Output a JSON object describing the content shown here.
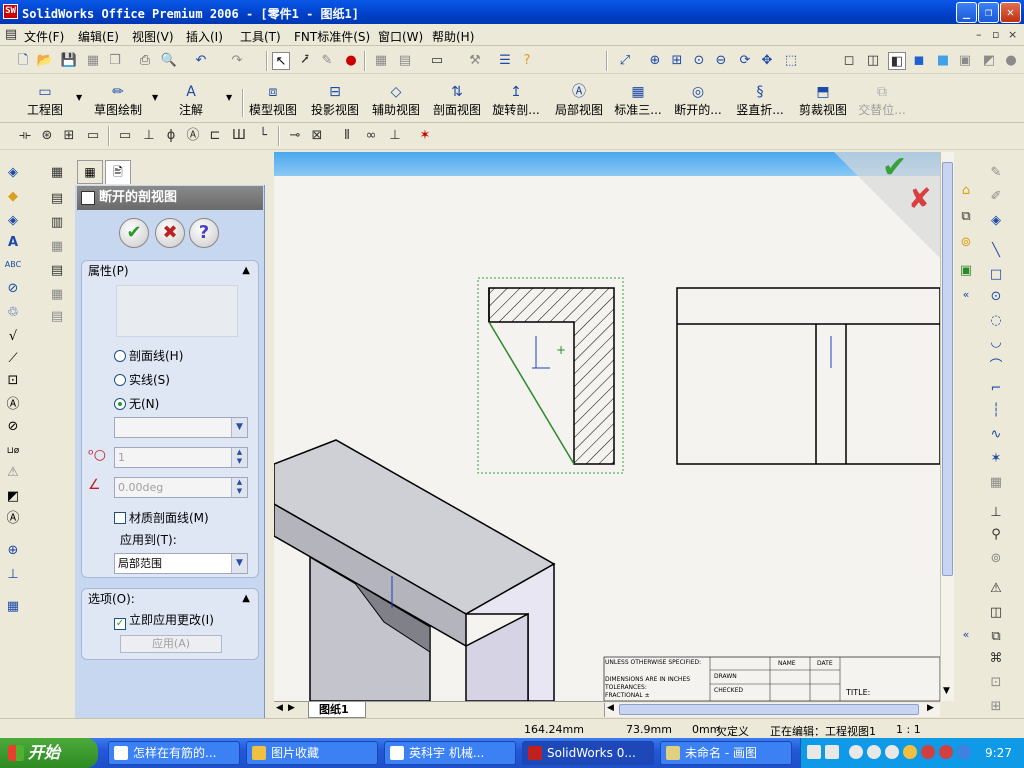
{
  "window": {
    "title": "SolidWorks Office Premium 2006 - [零件1 - 图纸1]",
    "app_icon": "SW",
    "controls": [
      "minimize",
      "restore",
      "close"
    ]
  },
  "menubar": {
    "items": [
      "文件(F)",
      "编辑(E)",
      "视图(V)",
      "插入(I)",
      "工具(T)",
      "FNT标准件(S)",
      "窗口(W)",
      "帮助(H)"
    ],
    "mdi_controls": [
      "–",
      "▫",
      "×"
    ]
  },
  "command_manager": {
    "items": [
      {
        "label": "工程图",
        "dropdown": true
      },
      {
        "label": "草图绘制",
        "dropdown": true
      },
      {
        "label": "注解",
        "dropdown": true
      },
      {
        "label": "模型视图"
      },
      {
        "label": "投影视图"
      },
      {
        "label": "辅助视图"
      },
      {
        "label": "剖面视图"
      },
      {
        "label": "旋转剖..."
      },
      {
        "label": "局部视图"
      },
      {
        "label": "标准三..."
      },
      {
        "label": "断开的..."
      },
      {
        "label": "竖直折..."
      },
      {
        "label": "剪裁视图"
      },
      {
        "label": "交替位...",
        "disabled": true
      }
    ]
  },
  "property_manager": {
    "title": "断开的剖视图",
    "ok_label": "✔",
    "cancel_label": "✖",
    "help_label": "?",
    "properties_group": {
      "header": "属性(P)",
      "radios": [
        {
          "label": "剖面线(H)",
          "selected": false
        },
        {
          "label": "实线(S)",
          "selected": false
        },
        {
          "label": "无(N)",
          "selected": true
        }
      ],
      "pattern_select": "",
      "scale_value": "1",
      "angle_value": "0.00deg",
      "material_hatch_label": "材质剖面线(M)",
      "material_hatch_checked": false,
      "apply_to_label": "应用到(T):",
      "apply_to_value": "局部范围"
    },
    "options_group": {
      "header": "选项(O):",
      "apply_immediately_label": "立即应用更改(I)",
      "apply_immediately_checked": true,
      "apply_button": "应用(A)"
    }
  },
  "sheet_tabs": {
    "active": "图纸1"
  },
  "title_block": {
    "unless": "UNLESS OTHERWISE SPECIFIED:",
    "dims": "DIMENSIONS ARE IN INCHES",
    "tol": "TOLERANCES:",
    "frac": "FRACTIONAL ±",
    "name": "NAME",
    "date": "DATE",
    "drawn": "DRAWN",
    "checked": "CHECKED",
    "title": "TITLE:"
  },
  "status": {
    "x": "164.24mm",
    "y": "73.9mm",
    "z": "0mm",
    "constraint": "欠定义",
    "editing": "正在编辑：工程视图1",
    "scale": "1 : 1"
  },
  "taskbar": {
    "start_label": "开始",
    "tasks": [
      {
        "label": "怎样在有筋的...",
        "active": false
      },
      {
        "label": "图片收藏",
        "active": false
      },
      {
        "label": "英科宇 机械...",
        "active": false
      },
      {
        "label": "SolidWorks 0...",
        "active": true
      },
      {
        "label": "未命名 - 画图",
        "active": false
      }
    ],
    "clock": "9:27"
  },
  "colors": {
    "title_blue": "#0a58e8",
    "panel_blue": "#c8d7f0",
    "canvas_bg": "#f5f3ef",
    "section_green": "#2a8a2a",
    "selection_green": "#3aa03a"
  }
}
